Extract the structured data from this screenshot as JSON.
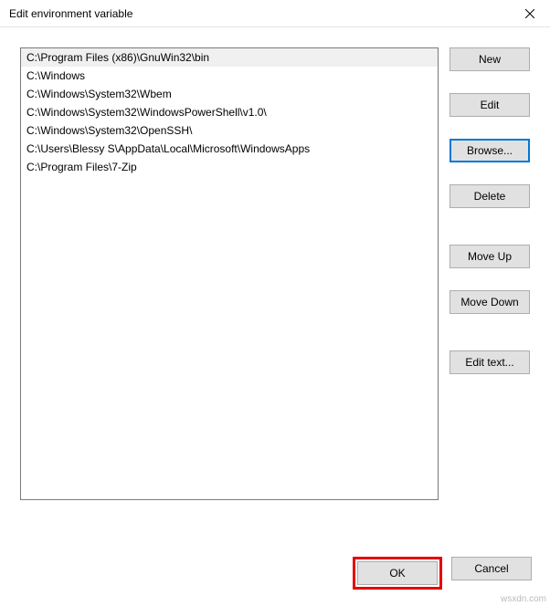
{
  "window": {
    "title": "Edit environment variable"
  },
  "list": {
    "items": [
      "C:\\Program Files (x86)\\GnuWin32\\bin",
      "C:\\Windows",
      "C:\\Windows\\System32\\Wbem",
      "C:\\Windows\\System32\\WindowsPowerShell\\v1.0\\",
      "C:\\Windows\\System32\\OpenSSH\\",
      "C:\\Users\\Blessy S\\AppData\\Local\\Microsoft\\WindowsApps",
      "C:\\Program Files\\7-Zip"
    ],
    "selected_index": 0
  },
  "buttons": {
    "new": "New",
    "edit": "Edit",
    "browse": "Browse...",
    "delete": "Delete",
    "move_up": "Move Up",
    "move_down": "Move Down",
    "edit_text": "Edit text...",
    "ok": "OK",
    "cancel": "Cancel"
  },
  "watermark": "wsxdn.com"
}
